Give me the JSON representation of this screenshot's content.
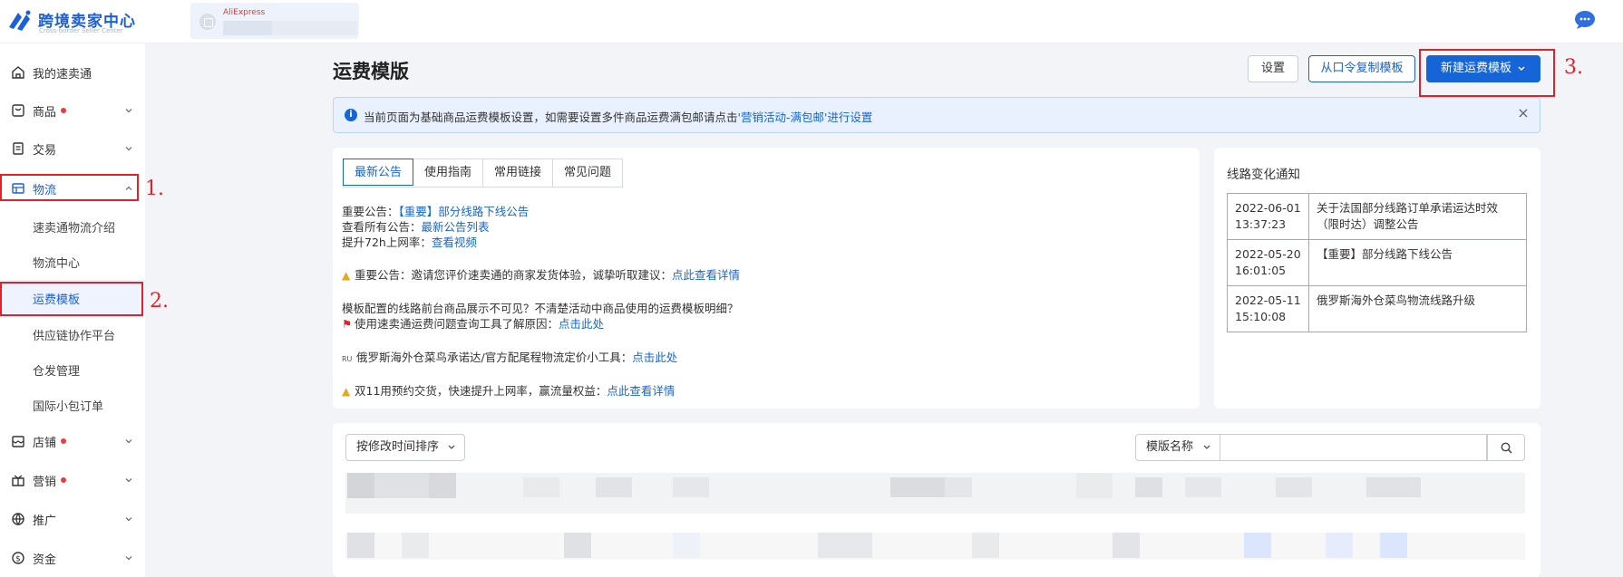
{
  "header": {
    "logo_title": "跨境卖家中心",
    "logo_subtitle": "Cross-border Seller Center",
    "store_label": "AliExpress",
    "brand_color": "#1b5fd9"
  },
  "sidebar": {
    "items": [
      {
        "label": "我的速卖通",
        "icon": "home-icon"
      },
      {
        "label": "商品",
        "icon": "product-icon",
        "dot": true
      },
      {
        "label": "交易",
        "icon": "order-icon"
      },
      {
        "label": "物流",
        "icon": "logistics-icon",
        "expanded": true
      },
      {
        "label": "店铺",
        "icon": "store-icon",
        "dot": true
      },
      {
        "label": "营销",
        "icon": "marketing-icon",
        "dot": true
      },
      {
        "label": "推广",
        "icon": "promotion-icon"
      },
      {
        "label": "资金",
        "icon": "funds-icon"
      }
    ],
    "logistics_children": [
      {
        "label": "速卖通物流介绍"
      },
      {
        "label": "物流中心"
      },
      {
        "label": "运费模板",
        "selected": true
      },
      {
        "label": "供应链协作平台"
      },
      {
        "label": "仓发管理"
      },
      {
        "label": "国际小包订单"
      }
    ]
  },
  "steps": [
    "1.",
    "2.",
    "3."
  ],
  "main": {
    "title": "运费模版",
    "buttons": {
      "settings": "设置",
      "copy": "从口令复制模板",
      "create": "新建运费模板"
    },
    "notice": {
      "text": "当前页面为基础商品运费模板设置，如需要设置多件商品运费满包邮请点击",
      "link": "'营销活动-满包邮'进行设置"
    },
    "tabs": [
      "最新公告",
      "使用指南",
      "常用链接",
      "常见问题"
    ],
    "announcements": {
      "l1_label": "重要公告：",
      "l1_link": "【重要】部分线路下线公告",
      "l2_label": "查看所有公告：",
      "l2_link": "最新公告列表",
      "l3_label": "提升72h上网率：",
      "l3_link": "查看视频",
      "l4_text": "重要公告：邀请您评价速卖通的商家发货体验，诚挚听取建议：",
      "l4_link": "点此查看详情",
      "l5_text": "模板配置的线路前台商品展示不可见？不清楚活动中商品使用的运费模板明细？",
      "l6_text": "使用速卖通运费问题查询工具了解原因：",
      "l6_link": "点击此处",
      "l7_prefix": "RU",
      "l7_text": "俄罗斯海外仓菜鸟承诺达/官方配尾程物流定价小工具：",
      "l7_link": "点击此处",
      "l8_text": "双11用预约交货，快速提升上网率，赢流量权益：",
      "l8_link": "点此查看详情"
    },
    "route_notice": {
      "title": "线路变化通知",
      "rows": [
        {
          "date": "2022-06-01",
          "time": "13:37:23",
          "text": "关于法国部分线路订单承诺运达时效（限时达）调整公告"
        },
        {
          "date": "2022-05-20",
          "time": "16:01:05",
          "text": "【重要】部分线路下线公告"
        },
        {
          "date": "2022-05-11",
          "time": "15:10:08",
          "text": "俄罗斯海外仓菜鸟物流线路升级"
        }
      ]
    },
    "filter": {
      "sort_label": "按修改时间排序",
      "field_label": "模版名称",
      "search_value": ""
    }
  }
}
